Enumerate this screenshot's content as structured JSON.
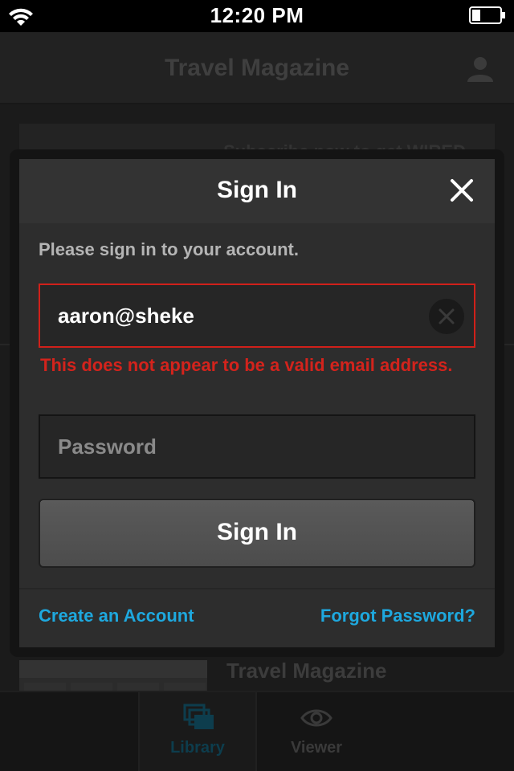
{
  "status_bar": {
    "time": "12:20 PM"
  },
  "app": {
    "nav_title": "Travel Magazine",
    "card_text": "Subscribe now to get WIRED",
    "issue_title": "Travel Magazine",
    "tabs": [
      {
        "label": "Library",
        "icon": "library-icon",
        "active": true
      },
      {
        "label": "Viewer",
        "icon": "eye-icon",
        "active": false
      }
    ]
  },
  "modal": {
    "title": "Sign In",
    "prompt": "Please sign in to your account.",
    "email": {
      "value": "aaron@sheke",
      "error": "This does not appear to be a valid email address."
    },
    "password": {
      "placeholder": "Password"
    },
    "submit_label": "Sign In",
    "create_account_label": "Create an Account",
    "forgot_password_label": "Forgot Password?"
  },
  "colors": {
    "error": "#d3231c",
    "link": "#1ea8de",
    "modal_bg": "#2d2d2d"
  }
}
